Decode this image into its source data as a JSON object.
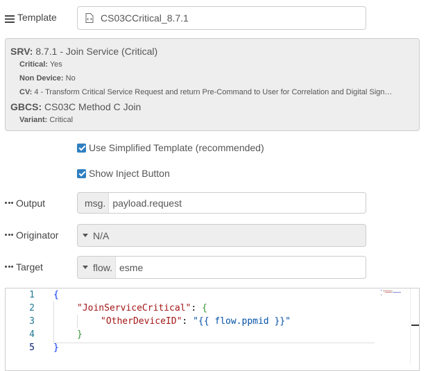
{
  "template": {
    "label": "Template",
    "value": "CS03CCritical_8.7.1"
  },
  "info": {
    "srv_label": "SRV:",
    "srv_value": "8.7.1 - Join Service (Critical)",
    "critical_label": "Critical:",
    "critical_value": "Yes",
    "nondevice_label": "Non Device:",
    "nondevice_value": "No",
    "cv_label": "CV:",
    "cv_value": "4 - Transform Critical Service Request and return Pre-Command to User for Correlation and Digital Sign…",
    "gbcs_label": "GBCS:",
    "gbcs_value": "CS03C Method C Join",
    "variant_label": "Variant:",
    "variant_value": "Critical"
  },
  "options": {
    "simplified_label": "Use Simplified Template (recommended)",
    "simplified_checked": true,
    "inject_label": "Show Inject Button",
    "inject_checked": true
  },
  "output": {
    "label": "Output",
    "prefix": "msg.",
    "value": "payload.request"
  },
  "originator": {
    "label": "Originator",
    "value": "N/A"
  },
  "target": {
    "label": "Target",
    "prefix": "flow.",
    "value": "esme"
  },
  "editor": {
    "line_numbers": [
      "1",
      "2",
      "3",
      "4",
      "5"
    ],
    "line1": "{",
    "key1": "\"JoinServiceCritical\"",
    "colon1": ": ",
    "brace_open2": "{",
    "key2": "\"OtherDeviceID\"",
    "colon2": ": ",
    "value2": "\"{{ flow.ppmid }}\"",
    "brace_close2": "}",
    "line5": "}"
  },
  "colors": {
    "accent": "#2f7fc1",
    "key": "#a31515",
    "string": "#0451a5",
    "brace_outer": "#0431fa",
    "brace_inner": "#319331",
    "line_number": "#237893"
  }
}
